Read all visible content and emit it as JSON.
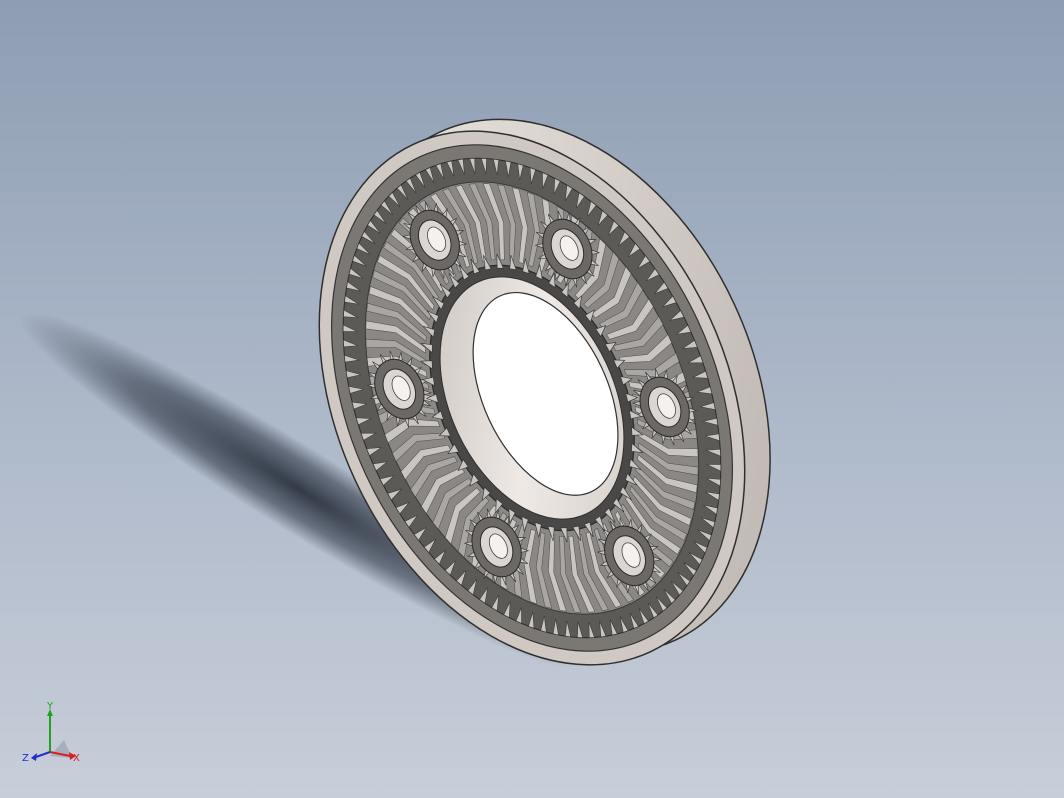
{
  "viewport": {
    "background_top": "#8e9db3",
    "background_bottom": "#c8ced9"
  },
  "model": {
    "part": "planetary-gear-assembly",
    "planet_gear_count": 6,
    "colors": {
      "ring_face": "#d9d3cf",
      "ring_dark": "#4a4a4a",
      "gear_tooth": "#a9a6a3",
      "gear_tooth_light": "#c9c5c1",
      "sun_bore": "#dcd6d2",
      "shadow": "#1c2330"
    }
  },
  "triad": {
    "x_label": "X",
    "y_label": "Y",
    "z_label": "Z",
    "x_color": "#d62020",
    "y_color": "#1ea31e",
    "z_color": "#2030d0"
  }
}
